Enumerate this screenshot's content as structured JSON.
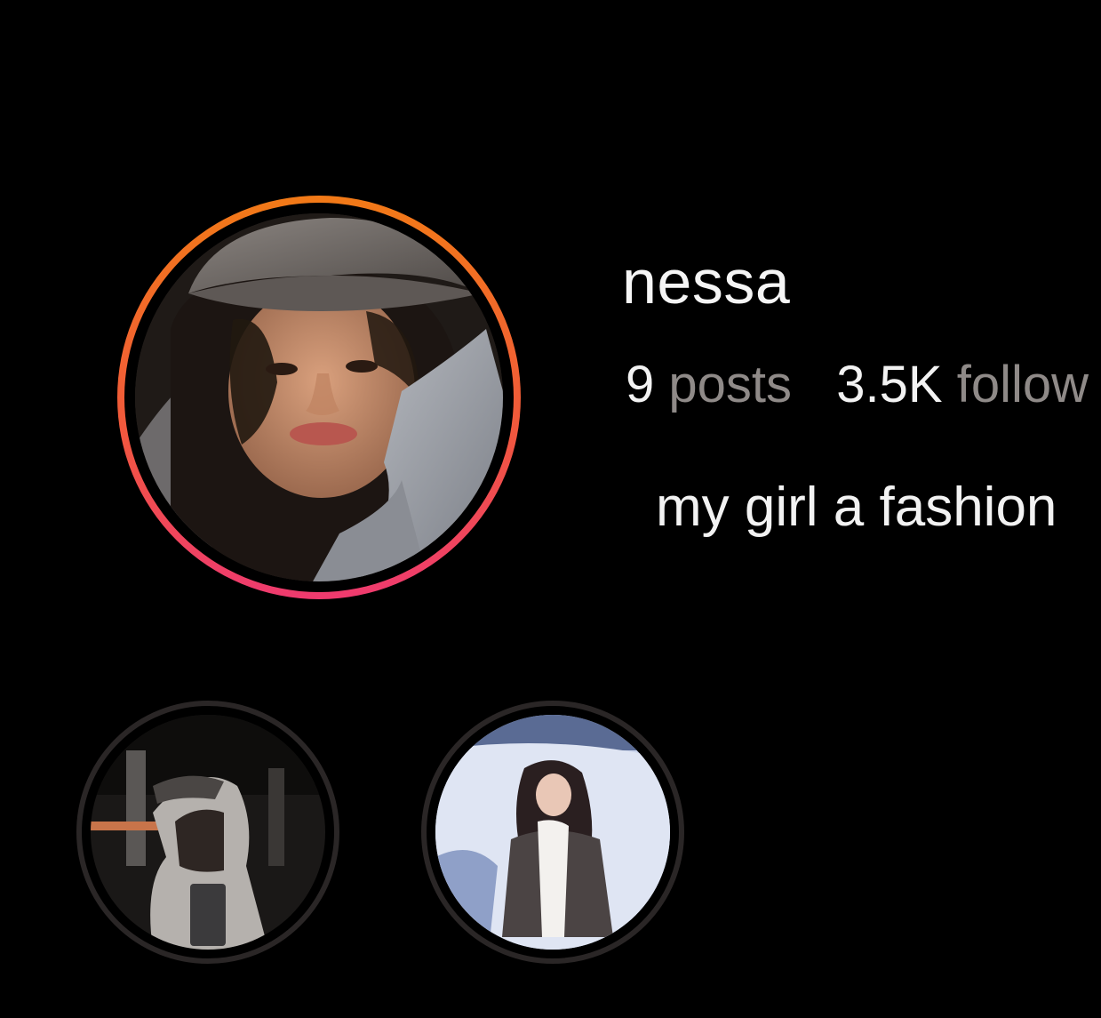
{
  "profile": {
    "username": "nessa",
    "posts_count": "9",
    "posts_label": "posts",
    "followers_count": "3.5K",
    "followers_label": "follow",
    "bio": "my girl a fashion",
    "story_ring_colors": [
      "#f27a17",
      "#f15a3a",
      "#ef3a6f"
    ]
  },
  "highlights": [
    {
      "icon": "highlight-photo-dark-hoodie"
    },
    {
      "icon": "highlight-photo-snow"
    }
  ]
}
